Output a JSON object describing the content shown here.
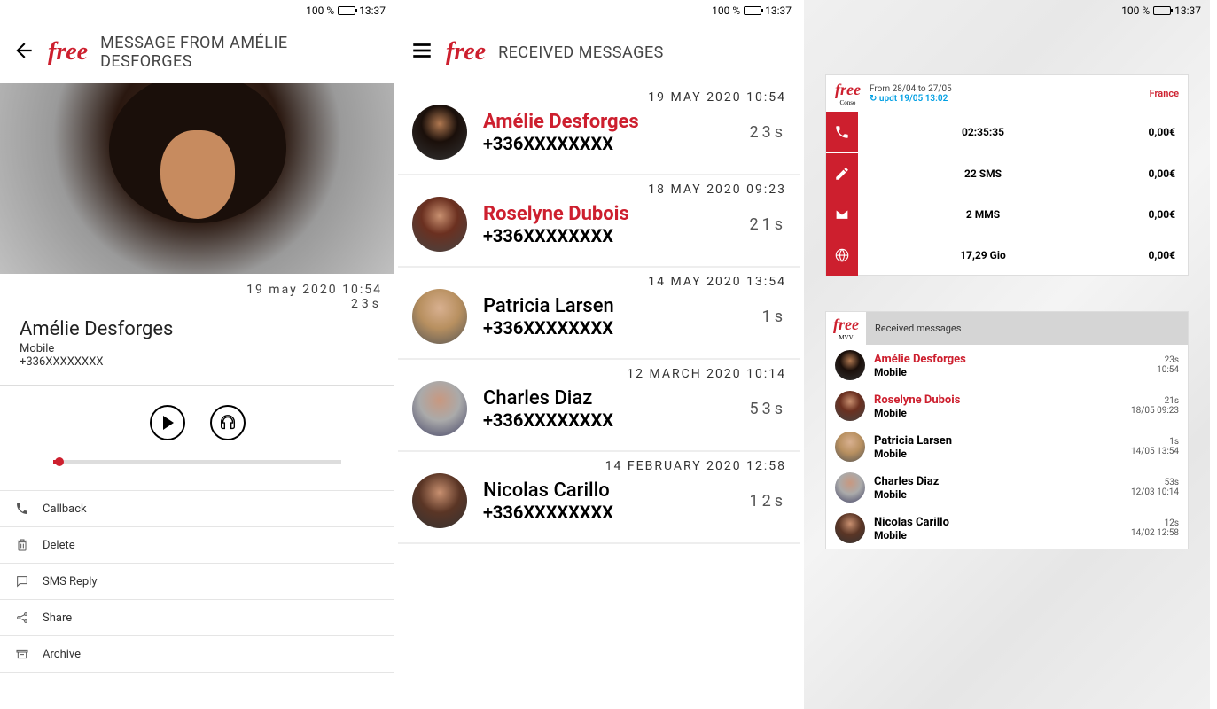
{
  "status": {
    "battery": "100 %",
    "time": "13:37"
  },
  "brand": "free",
  "pane1": {
    "title": "MESSAGE FROM AMÉLIE DESFORGES",
    "datetime": "19 may 2020 10:54",
    "duration": "23s",
    "name": "Amélie Desforges",
    "type": "Mobile",
    "number": "+336XXXXXXXX",
    "actions": {
      "callback": "Callback",
      "delete": "Delete",
      "sms_reply": "SMS Reply",
      "share": "Share",
      "archive": "Archive"
    }
  },
  "pane2": {
    "title": "RECEIVED MESSAGES",
    "items": [
      {
        "date": "19 MAY 2020 10:54",
        "dur": "23s",
        "name": "Amélie Desforges",
        "num": "+336XXXXXXXX",
        "unread": true,
        "av": "av1"
      },
      {
        "date": "18 MAY 2020 09:23",
        "dur": "21s",
        "name": "Roselyne Dubois",
        "num": "+336XXXXXXXX",
        "unread": true,
        "av": "av2"
      },
      {
        "date": "14 MAY 2020 13:54",
        "dur": "1s",
        "name": "Patricia Larsen",
        "num": "+336XXXXXXXX",
        "unread": false,
        "av": "av3"
      },
      {
        "date": "12 MARCH 2020 10:14",
        "dur": "53s",
        "name": "Charles Diaz",
        "num": "+336XXXXXXXX",
        "unread": false,
        "av": "av4"
      },
      {
        "date": "14 FEBRUARY 2020 12:58",
        "dur": "12s",
        "name": "Nicolas Carillo",
        "num": "+336XXXXXXXX",
        "unread": false,
        "av": "av5"
      }
    ]
  },
  "pane3": {
    "conso": {
      "sub": "Conso",
      "period": "From 28/04 to 27/05",
      "updated_prefix": "updt",
      "updated": "19/05 13:02",
      "country": "France",
      "rows": [
        {
          "icon": "phone",
          "val": "02:35:35",
          "cost": "0,00€"
        },
        {
          "icon": "pencil",
          "val": "22 SMS",
          "cost": "0,00€"
        },
        {
          "icon": "envelope",
          "val": "2 MMS",
          "cost": "0,00€"
        },
        {
          "icon": "globe",
          "val": "17,29 Gio",
          "cost": "0,00€"
        }
      ]
    },
    "msgs": {
      "sub": "MVV",
      "title": "Received messages",
      "items": [
        {
          "name": "Amélie Desforges",
          "type": "Mobile",
          "dur": "23s",
          "time": "10:54",
          "unread": true,
          "av": "av1"
        },
        {
          "name": "Roselyne Dubois",
          "type": "Mobile",
          "dur": "21s",
          "time": "18/05 09:23",
          "unread": true,
          "av": "av2"
        },
        {
          "name": "Patricia Larsen",
          "type": "Mobile",
          "dur": "1s",
          "time": "14/05 13:54",
          "unread": false,
          "av": "av3"
        },
        {
          "name": "Charles Diaz",
          "type": "Mobile",
          "dur": "53s",
          "time": "12/03 10:14",
          "unread": false,
          "av": "av4"
        },
        {
          "name": "Nicolas Carillo",
          "type": "Mobile",
          "dur": "12s",
          "time": "14/02 12:58",
          "unread": false,
          "av": "av5"
        }
      ]
    }
  }
}
